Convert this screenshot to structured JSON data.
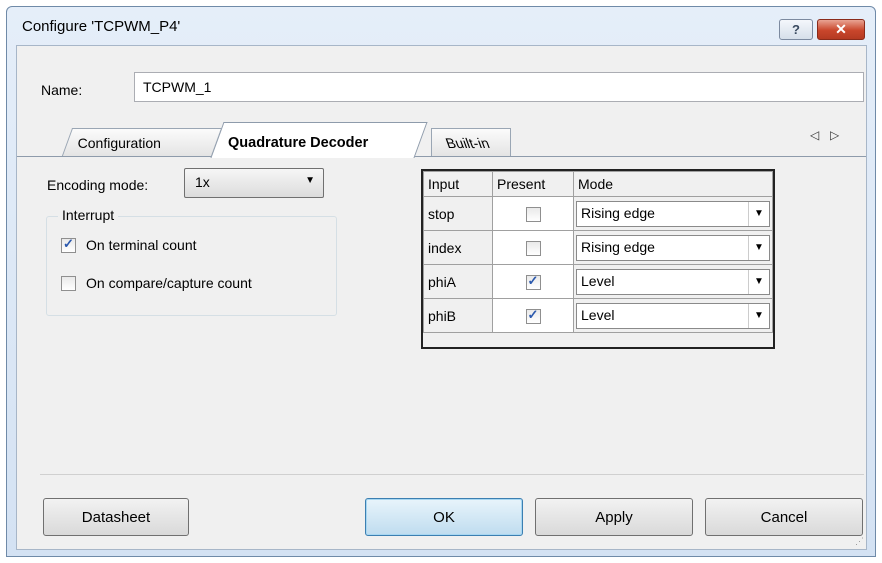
{
  "window": {
    "title": "Configure 'TCPWM_P4'",
    "help_glyph": "?",
    "close_glyph": "✕"
  },
  "name_field": {
    "label": "Name:",
    "value": "TCPWM_1"
  },
  "tabs": [
    {
      "label": "Configuration",
      "active": false
    },
    {
      "label": "Quadrature Decoder",
      "active": true
    },
    {
      "label": "Built-in",
      "active": false
    }
  ],
  "tab_scroll": {
    "left": "◁",
    "right": "▷"
  },
  "encoding": {
    "label": "Encoding mode:",
    "value": "1x",
    "arrow": "▼"
  },
  "interrupt": {
    "legend": "Interrupt",
    "options": [
      {
        "label": "On terminal count",
        "checked": true
      },
      {
        "label": "On compare/capture count",
        "checked": false
      }
    ]
  },
  "signals": {
    "headers": [
      "Input",
      "Present",
      "Mode"
    ],
    "rows": [
      {
        "input": "stop",
        "present": false,
        "mode": "Rising edge"
      },
      {
        "input": "index",
        "present": false,
        "mode": "Rising edge"
      },
      {
        "input": "phiA",
        "present": true,
        "mode": "Level"
      },
      {
        "input": "phiB",
        "present": true,
        "mode": "Level"
      }
    ],
    "dropdown_arrow": "▼"
  },
  "buttons": {
    "datasheet": "Datasheet",
    "ok": "OK",
    "apply": "Apply",
    "cancel": "Cancel"
  },
  "colors": {
    "title_gradient_top": "#e5eef9",
    "close_red": "#c9462b",
    "ok_border": "#3c7fb1",
    "check_blue": "#2a58ad"
  }
}
